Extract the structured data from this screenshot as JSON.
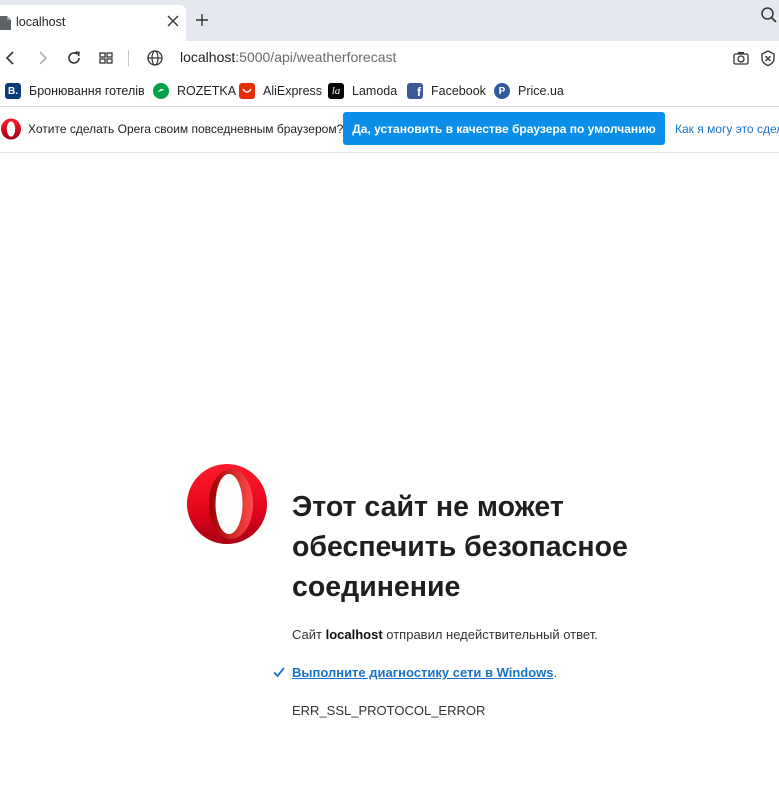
{
  "tab": {
    "title": "localhost"
  },
  "address": {
    "host": "localhost",
    "path": ":5000/api/weatherforecast"
  },
  "bookmarks": [
    {
      "label": "Бронювання готелів",
      "icon": "booking-icon",
      "icon_text": "B.",
      "color": "#0c3b7c"
    },
    {
      "label": "ROZETKA",
      "icon": "rozetka-icon",
      "icon_text": "",
      "color": "#00a046"
    },
    {
      "label": "AliExpress",
      "icon": "aliexpress-icon",
      "icon_text": "",
      "color": "#e62e04"
    },
    {
      "label": "Lamoda",
      "icon": "lamoda-icon",
      "icon_text": "la",
      "color": "#000000"
    },
    {
      "label": "Facebook",
      "icon": "facebook-icon",
      "icon_text": "f",
      "color": "#3b5998"
    },
    {
      "label": "Price.ua",
      "icon": "priceua-icon",
      "icon_text": "P",
      "color": "#2f5a9e"
    }
  ],
  "infobar": {
    "text": "Хотите сделать Opera своим повседневным браузером?",
    "button": "Да, установить в качестве браузера по умолчанию",
    "link": "Как я могу это сдел"
  },
  "error": {
    "title": "Этот сайт не может обеспечить безопасное соединение",
    "desc_prefix": "Сайт ",
    "desc_host": "localhost",
    "desc_suffix": " отправил недействительный ответ.",
    "diagnostic_link": "Выполните диагностику сети в Windows",
    "diagnostic_dot": ".",
    "code": "ERR_SSL_PROTOCOL_ERROR"
  },
  "colors": {
    "accent": "#0b8ee8",
    "opera_red": "#ff1b2d",
    "link": "#1a73c8"
  }
}
